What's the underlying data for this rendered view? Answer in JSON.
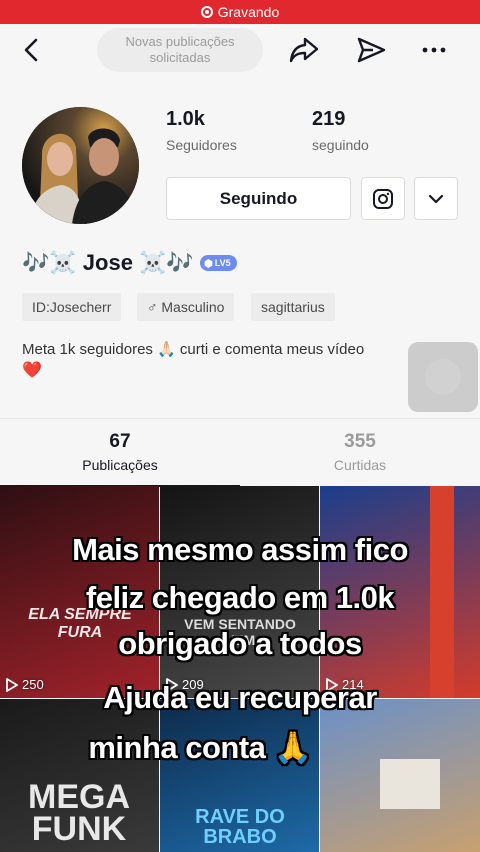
{
  "status_bar": {
    "recording_label": "Gravando"
  },
  "nav": {
    "new_posts_pill": "Novas publicações solicitadas",
    "icons": [
      "back-arrow-icon",
      "repost-arrow-icon",
      "send-icon",
      "more-icon"
    ]
  },
  "profile": {
    "followers_count": "1.0k",
    "followers_label": "Seguidores",
    "following_count": "219",
    "following_label": "seguindo",
    "follow_button": "Seguindo",
    "name_prefix": "🎶☠️",
    "name": "Jose",
    "name_suffix": "☠️🎶",
    "level_badge": "LV5",
    "chips": [
      "ID:Josecherr",
      "♂ Masculino",
      "sagittarius"
    ],
    "bio_text": "Meta 1k seguidores 🙏🏻 curti e comenta meus vídeo",
    "bio_emoji": "❤️"
  },
  "tabs": [
    {
      "count": "67",
      "label": "Publicações",
      "active": true
    },
    {
      "count": "355",
      "label": "Curtidas",
      "active": false
    }
  ],
  "videos": [
    {
      "views": "250",
      "title": "ELA SEMPRE FURA",
      "colors": [
        "#2e0f12",
        "#a3222b"
      ]
    },
    {
      "views": "209",
      "title": "VEM SENTANDO VEM",
      "colors": [
        "#141414",
        "#4b4b4b"
      ]
    },
    {
      "views": "214",
      "title": "",
      "colors": [
        "#1a3e8c",
        "#d43b2a"
      ]
    },
    {
      "views": "",
      "title": "MEGA FUNK",
      "colors": [
        "#1a1a1a",
        "#3a3a3a"
      ]
    },
    {
      "views": "",
      "title": "RAVE DO BRABO",
      "colors": [
        "#0d2a4a",
        "#1e6aa8"
      ]
    },
    {
      "views": "",
      "title": "",
      "colors": [
        "#6a90c8",
        "#c8a070"
      ]
    }
  ],
  "captions": {
    "line1": "Mais mesmo assim fico",
    "line2": "feliz chegado em 1.0k",
    "line3": "obrigado a todos",
    "line4": "Ajuda eu recuperar",
    "line5": "minha conta 🙏"
  },
  "colors": {
    "accent": "#e0282e",
    "badge": "#6c8cf2"
  }
}
